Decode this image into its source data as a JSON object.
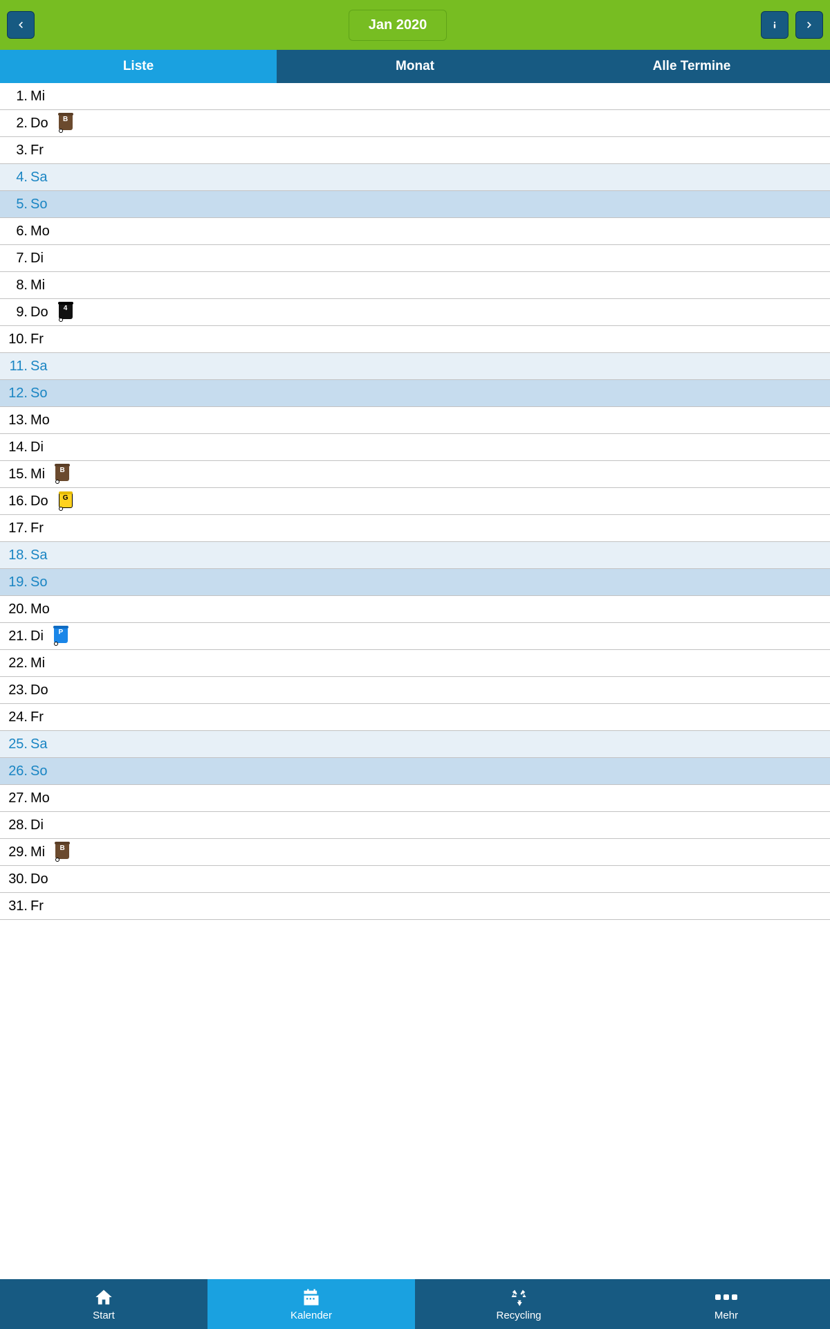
{
  "header": {
    "month_label": "Jan 2020"
  },
  "tabs": [
    {
      "label": "Liste",
      "active": true
    },
    {
      "label": "Monat",
      "active": false
    },
    {
      "label": "Alle Termine",
      "active": false
    }
  ],
  "days": [
    {
      "n": "1.",
      "dow": "Mi",
      "kind": "weekday",
      "bin": null
    },
    {
      "n": "2.",
      "dow": "Do",
      "kind": "weekday",
      "bin": {
        "color": "brown",
        "letter": "B"
      }
    },
    {
      "n": "3.",
      "dow": "Fr",
      "kind": "weekday",
      "bin": null
    },
    {
      "n": "4.",
      "dow": "Sa",
      "kind": "sat",
      "bin": null
    },
    {
      "n": "5.",
      "dow": "So",
      "kind": "sun",
      "bin": null
    },
    {
      "n": "6.",
      "dow": "Mo",
      "kind": "weekday",
      "bin": null
    },
    {
      "n": "7.",
      "dow": "Di",
      "kind": "weekday",
      "bin": null
    },
    {
      "n": "8.",
      "dow": "Mi",
      "kind": "weekday",
      "bin": null
    },
    {
      "n": "9.",
      "dow": "Do",
      "kind": "weekday",
      "bin": {
        "color": "black",
        "letter": "4"
      }
    },
    {
      "n": "10.",
      "dow": "Fr",
      "kind": "weekday",
      "bin": null
    },
    {
      "n": "11.",
      "dow": "Sa",
      "kind": "sat",
      "bin": null
    },
    {
      "n": "12.",
      "dow": "So",
      "kind": "sun",
      "bin": null
    },
    {
      "n": "13.",
      "dow": "Mo",
      "kind": "weekday",
      "bin": null
    },
    {
      "n": "14.",
      "dow": "Di",
      "kind": "weekday",
      "bin": null
    },
    {
      "n": "15.",
      "dow": "Mi",
      "kind": "weekday",
      "bin": {
        "color": "brown",
        "letter": "B"
      }
    },
    {
      "n": "16.",
      "dow": "Do",
      "kind": "weekday",
      "bin": {
        "color": "yellow",
        "letter": "G"
      }
    },
    {
      "n": "17.",
      "dow": "Fr",
      "kind": "weekday",
      "bin": null
    },
    {
      "n": "18.",
      "dow": "Sa",
      "kind": "sat",
      "bin": null
    },
    {
      "n": "19.",
      "dow": "So",
      "kind": "sun",
      "bin": null
    },
    {
      "n": "20.",
      "dow": "Mo",
      "kind": "weekday",
      "bin": null
    },
    {
      "n": "21.",
      "dow": "Di",
      "kind": "weekday",
      "bin": {
        "color": "blue",
        "letter": "P"
      }
    },
    {
      "n": "22.",
      "dow": "Mi",
      "kind": "weekday",
      "bin": null
    },
    {
      "n": "23.",
      "dow": "Do",
      "kind": "weekday",
      "bin": null
    },
    {
      "n": "24.",
      "dow": "Fr",
      "kind": "weekday",
      "bin": null
    },
    {
      "n": "25.",
      "dow": "Sa",
      "kind": "sat",
      "bin": null
    },
    {
      "n": "26.",
      "dow": "So",
      "kind": "sun",
      "bin": null
    },
    {
      "n": "27.",
      "dow": "Mo",
      "kind": "weekday",
      "bin": null
    },
    {
      "n": "28.",
      "dow": "Di",
      "kind": "weekday",
      "bin": null
    },
    {
      "n": "29.",
      "dow": "Mi",
      "kind": "weekday",
      "bin": {
        "color": "brown",
        "letter": "B"
      }
    },
    {
      "n": "30.",
      "dow": "Do",
      "kind": "weekday",
      "bin": null
    },
    {
      "n": "31.",
      "dow": "Fr",
      "kind": "weekday",
      "bin": null
    }
  ],
  "bottom_nav": [
    {
      "label": "Start",
      "icon": "home",
      "active": false
    },
    {
      "label": "Kalender",
      "icon": "calendar",
      "active": true
    },
    {
      "label": "Recycling",
      "icon": "recycle",
      "active": false
    },
    {
      "label": "Mehr",
      "icon": "dots",
      "active": false
    }
  ]
}
